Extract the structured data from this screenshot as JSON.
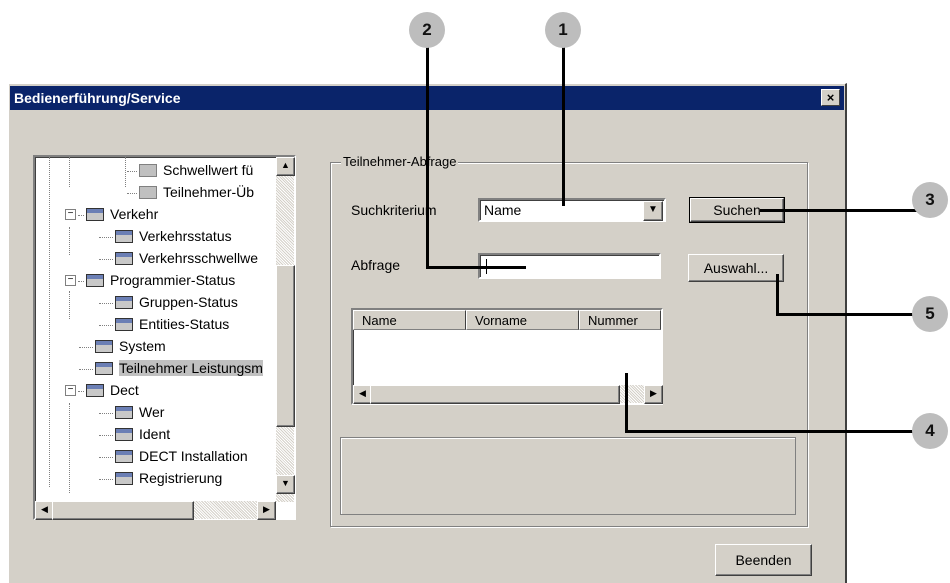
{
  "window": {
    "title": "Bedienerführung/Service",
    "close_glyph": "×"
  },
  "tree": {
    "items": [
      {
        "label": "Schwellwert fü"
      },
      {
        "label": "Teilnehmer-Üb"
      },
      {
        "label": "Verkehr"
      },
      {
        "label": "Verkehrsstatus"
      },
      {
        "label": "Verkehrsschwellwe"
      },
      {
        "label": "Programmier-Status"
      },
      {
        "label": "Gruppen-Status"
      },
      {
        "label": "Entities-Status"
      },
      {
        "label": "System"
      },
      {
        "label": "Teilnehmer Leistungsm"
      },
      {
        "label": "Dect"
      },
      {
        "label": "Wer"
      },
      {
        "label": "Ident"
      },
      {
        "label": "DECT Installation"
      },
      {
        "label": "Registrierung"
      }
    ],
    "expander_glyph": "−"
  },
  "query": {
    "group_title": "Teilnehmer-Abfrage",
    "criterion_label": "Suchkriterium",
    "criterion_value": "Name",
    "query_label": "Abfrage",
    "query_value": "",
    "search_button": "Suchen",
    "select_button": "Auswahl...",
    "columns": [
      "Name",
      "Vorname",
      "Nummer"
    ]
  },
  "footer": {
    "close_button": "Beenden"
  },
  "callouts": [
    "1",
    "2",
    "3",
    "4",
    "5"
  ],
  "colors": {
    "titlebar": "#0a246a",
    "dialog_bg": "#d4d0c8",
    "callout_bg": "#bdbdbd"
  }
}
